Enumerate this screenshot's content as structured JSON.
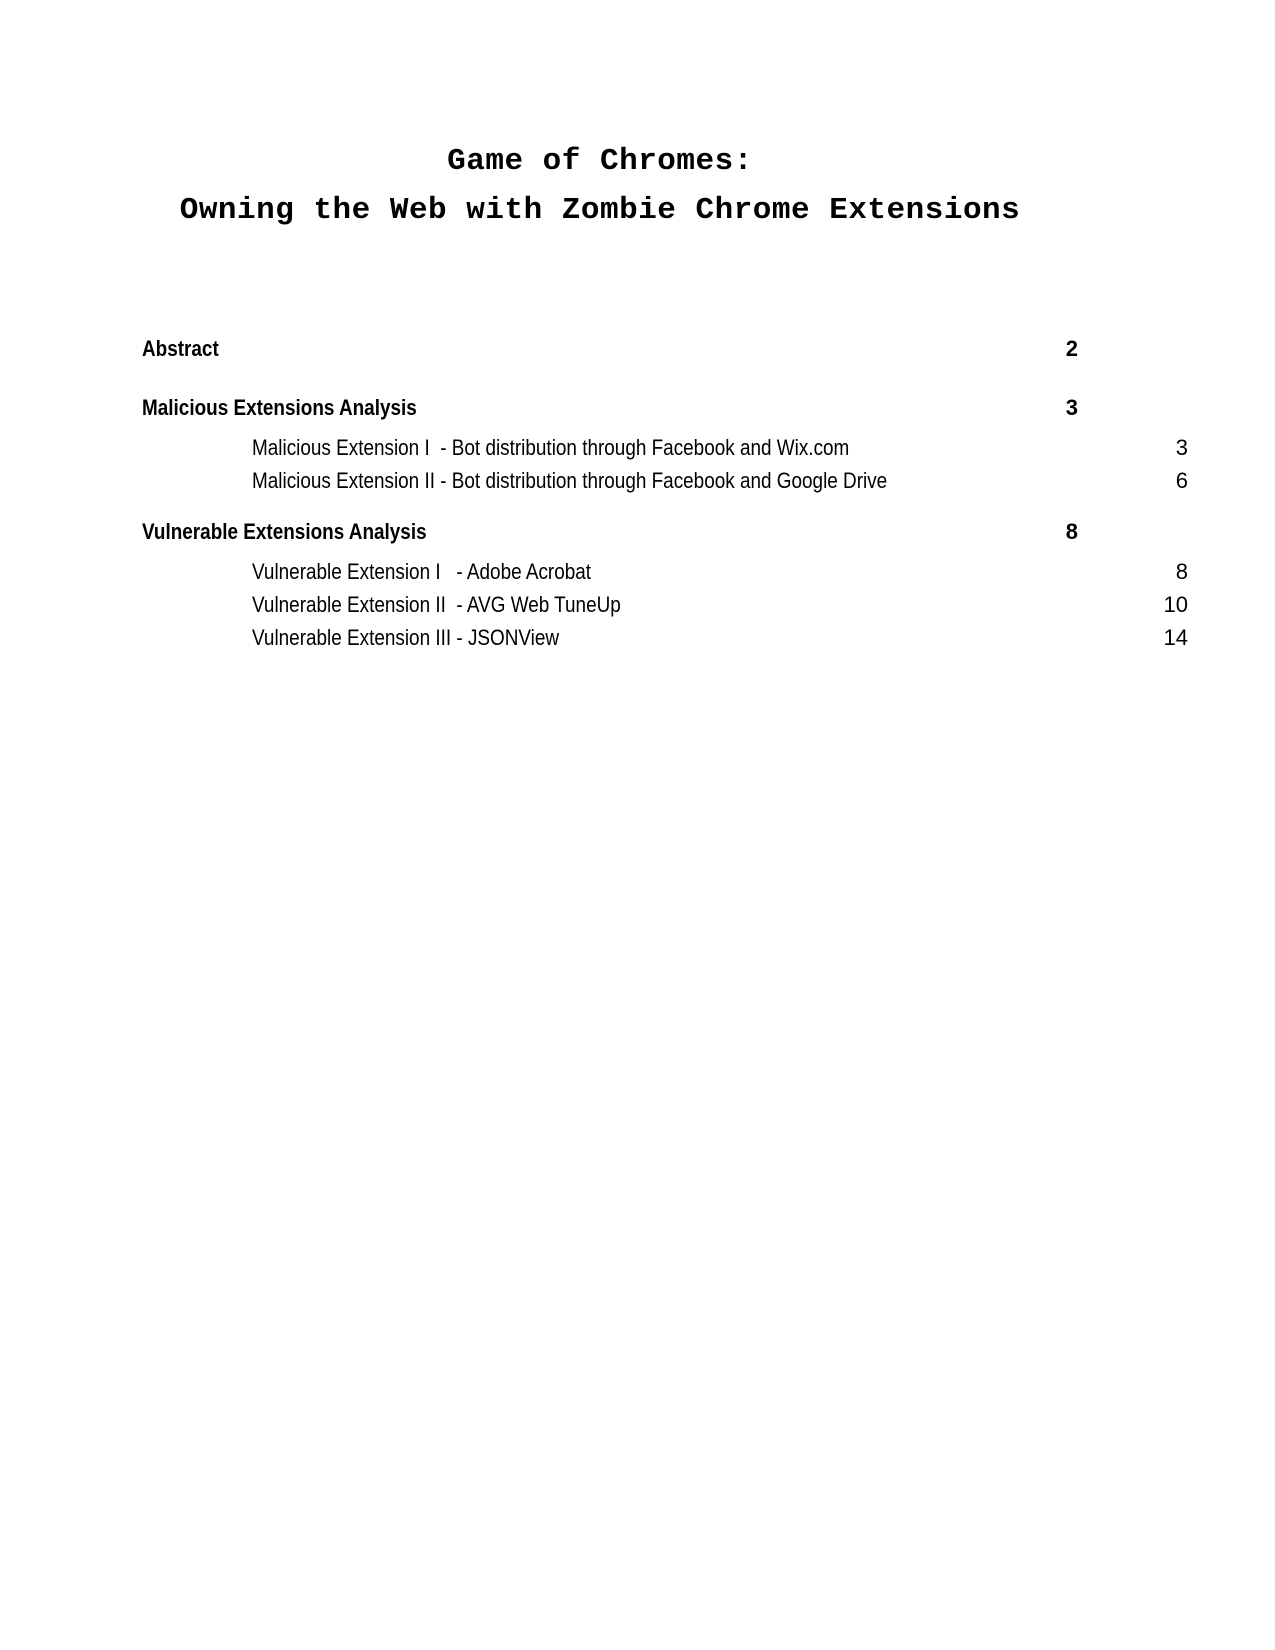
{
  "document": {
    "title_lines": [
      "Game of Chromes:",
      "Owning the Web with Zombie Chrome Extensions"
    ]
  },
  "toc": {
    "entries": [
      {
        "level": 1,
        "label": "Abstract",
        "page": "2"
      },
      {
        "level": 1,
        "label": "Malicious Extensions Analysis",
        "page": "3"
      },
      {
        "level": 2,
        "label": "Malicious Extension I  - Bot distribution through Facebook and Wix.com",
        "page": "3"
      },
      {
        "level": 2,
        "label": "Malicious Extension II - Bot distribution through Facebook and Google Drive",
        "page": "6"
      },
      {
        "level": 1,
        "label": "Vulnerable Extensions Analysis",
        "page": "8"
      },
      {
        "level": 2,
        "label": "Vulnerable Extension I   - Adobe Acrobat",
        "page": "8"
      },
      {
        "level": 2,
        "label": "Vulnerable Extension II  - AVG Web TuneUp",
        "page": "10"
      },
      {
        "level": 2,
        "label": "Vulnerable Extension III - JSONView",
        "page": "14"
      }
    ]
  },
  "colors": {
    "page_background": "#ffffff",
    "text": "#000000"
  }
}
